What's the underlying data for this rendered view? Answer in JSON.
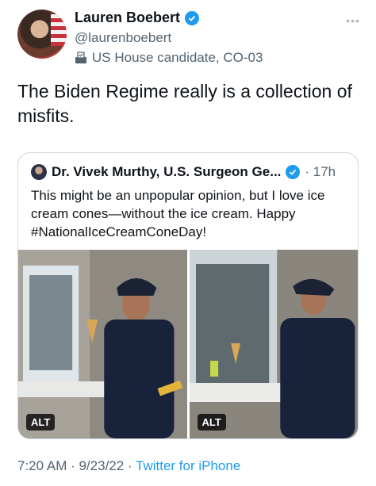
{
  "author": {
    "display_name": "Lauren Boebert",
    "handle": "@laurenboebert",
    "label": "US House candidate, CO-03"
  },
  "tweet": {
    "text": "The Biden Regime really is a collection of misfits.",
    "timestamp": "7:20 AM · 9/23/22 · ",
    "source": "Twitter for iPhone"
  },
  "quoted_tweet": {
    "display_name": "Dr. Vivek Murthy, U.S. Surgeon Ge...",
    "time": "· 17h",
    "text": "This might be an unpopular opinion, but I love ice cream cones—without the ice cream. Happy #NationalIceCreamConeDay!",
    "photo_alt_labels": [
      "ALT",
      "ALT"
    ]
  },
  "colors": {
    "accent": "#1d9bf0",
    "secondary_text": "#536471",
    "border": "#cfd9de"
  },
  "icons": [
    "verified-badge-icon",
    "ballot-box-icon",
    "more-icon"
  ]
}
